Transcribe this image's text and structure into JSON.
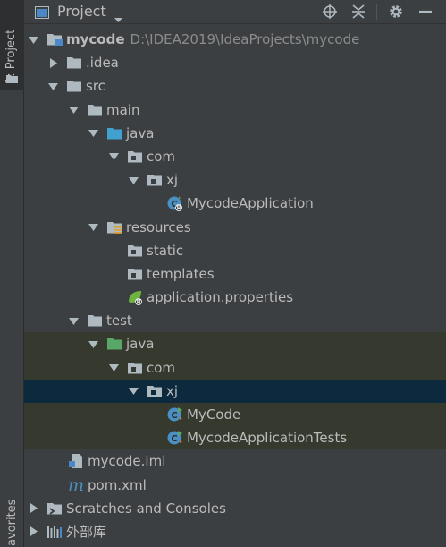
{
  "left_strip": {
    "project_tab": "1: Project",
    "favorites_tab": "avorites"
  },
  "header": {
    "title": "Project"
  },
  "tree": [
    {
      "label": "mycode",
      "path": "D:\\IDEA2019\\IdeaProjects\\mycode",
      "icon": "module-folder-icon",
      "expanded": true
    },
    {
      "label": ".idea",
      "icon": "folder-icon",
      "expanded": false
    },
    {
      "label": "src",
      "icon": "folder-icon",
      "expanded": true
    },
    {
      "label": "main",
      "icon": "folder-icon",
      "expanded": true
    },
    {
      "label": "java",
      "icon": "source-root-icon",
      "expanded": true
    },
    {
      "label": "com",
      "icon": "package-icon",
      "expanded": true
    },
    {
      "label": "xj",
      "icon": "package-icon",
      "expanded": true
    },
    {
      "label": "MycodeApplication",
      "icon": "spring-boot-class-icon"
    },
    {
      "label": "resources",
      "icon": "resources-root-icon",
      "expanded": true
    },
    {
      "label": "static",
      "icon": "package-icon"
    },
    {
      "label": "templates",
      "icon": "package-icon"
    },
    {
      "label": "application.properties",
      "icon": "spring-properties-icon"
    },
    {
      "label": "test",
      "icon": "folder-icon",
      "expanded": true
    },
    {
      "label": "java",
      "icon": "test-root-icon",
      "expanded": true
    },
    {
      "label": "com",
      "icon": "package-icon",
      "expanded": true
    },
    {
      "label": "xj",
      "icon": "package-icon",
      "expanded": true,
      "selected": true
    },
    {
      "label": "MyCode",
      "icon": "test-class-icon"
    },
    {
      "label": "MycodeApplicationTests",
      "icon": "test-class-icon"
    },
    {
      "label": "mycode.iml",
      "icon": "iml-file-icon"
    },
    {
      "label": "pom.xml",
      "icon": "maven-icon"
    },
    {
      "label": "Scratches and Consoles",
      "icon": "scratches-icon",
      "expanded": false
    },
    {
      "label": "外部库",
      "icon": "libraries-icon",
      "expanded": false
    }
  ],
  "colors": {
    "panel_bg": "#3c3f41",
    "test_bg": "#35392e",
    "selected_bg": "#0d293e",
    "folder": "#aeb9c0",
    "source_root": "#40a0d0",
    "test_root": "#59a869",
    "class_circle": "#4a90c2"
  }
}
